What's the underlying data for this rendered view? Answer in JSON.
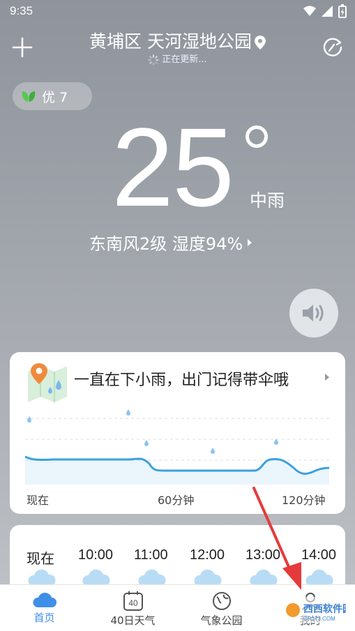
{
  "status_bar": {
    "time": "9:35"
  },
  "header": {
    "location": "黄埔区 天河湿地公园",
    "updating_text": "正在更新..."
  },
  "aqi": {
    "label": "优 7"
  },
  "current": {
    "temperature": "25",
    "condition": "中雨",
    "wind_humidity": "东南风2级  湿度94%"
  },
  "precip_card": {
    "message": "一直在下小雨，出门记得带伞哦",
    "x_labels": [
      "现在",
      "60分钟",
      "120分钟"
    ]
  },
  "hourly": {
    "hours": [
      "现在",
      "10:00",
      "11:00",
      "12:00",
      "13:00",
      "14:00"
    ]
  },
  "tabs": [
    {
      "label": "首页",
      "active": true
    },
    {
      "label": "40日天气",
      "icon_text": "40"
    },
    {
      "label": "气象公园"
    },
    {
      "label": "我的"
    }
  ],
  "watermark": {
    "text": "西西软件园",
    "url_text": "CR173.COM"
  },
  "colors": {
    "accent": "#3f8fe8",
    "chart_line": "#3aa0e0",
    "annotation_arrow": "#e63a3a"
  }
}
